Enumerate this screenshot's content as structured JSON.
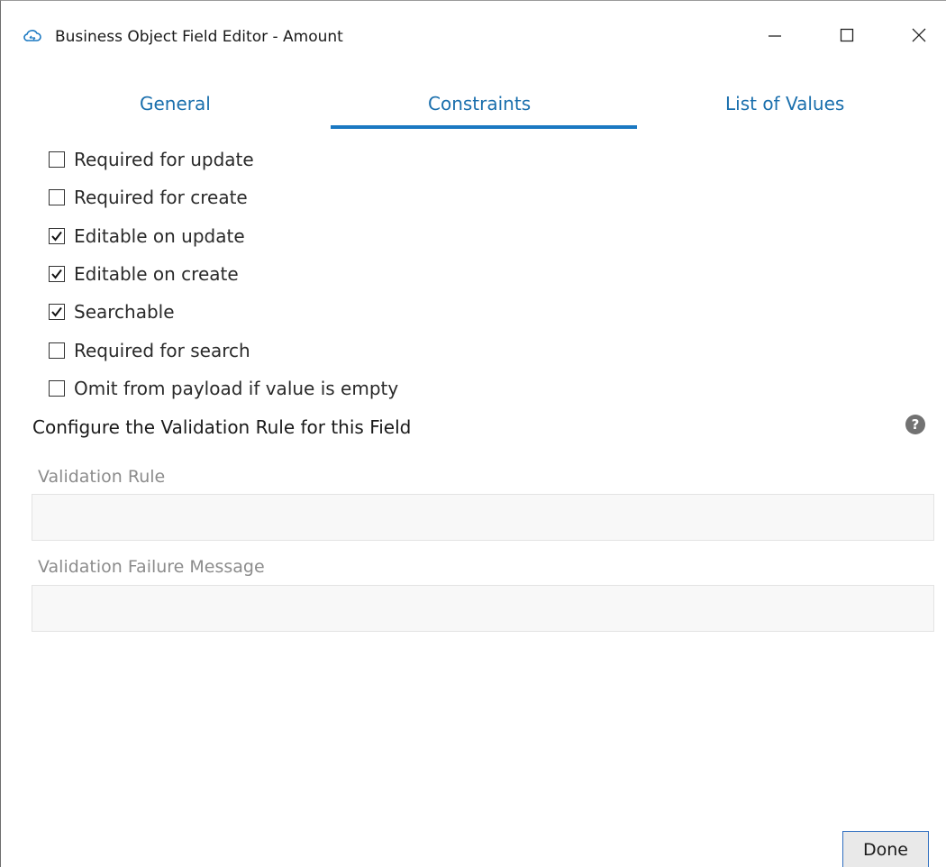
{
  "window": {
    "title": "Business Object Field Editor - Amount",
    "app_icon": "cloud-icon",
    "controls": {
      "minimize": "minimize-icon",
      "maximize": "maximize-icon",
      "close": "close-icon"
    }
  },
  "tabs": [
    {
      "label": "General",
      "selected": false
    },
    {
      "label": "Constraints",
      "selected": true
    },
    {
      "label": "List of Values",
      "selected": false
    }
  ],
  "constraints": [
    {
      "label": "Required for update",
      "checked": false
    },
    {
      "label": "Required for create",
      "checked": false
    },
    {
      "label": "Editable on update",
      "checked": true
    },
    {
      "label": "Editable on create",
      "checked": true
    },
    {
      "label": "Searchable",
      "checked": true
    },
    {
      "label": "Required for search",
      "checked": false
    },
    {
      "label": "Omit from payload if value is empty",
      "checked": false
    }
  ],
  "validation": {
    "section_title": "Configure the Validation Rule for this Field",
    "help_icon": "question-circle-icon",
    "help_glyph": "?",
    "rule_label": "Validation Rule",
    "rule_value": "",
    "message_label": "Validation Failure Message",
    "message_value": ""
  },
  "footer": {
    "done_label": "Done"
  },
  "colors": {
    "tab_text": "#1a6fad",
    "tab_underline": "#1a78c2",
    "done_border": "#2f6fc0",
    "disabled_label": "#8c8c8c"
  }
}
